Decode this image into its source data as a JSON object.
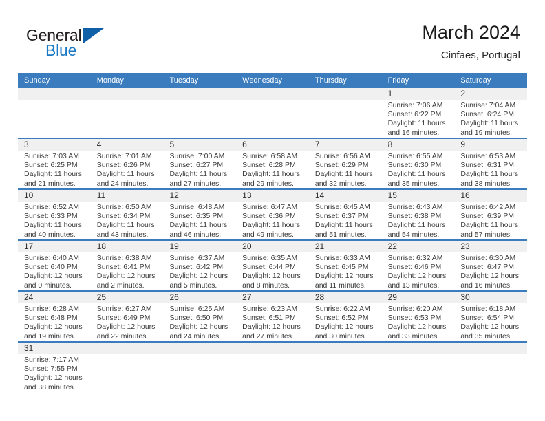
{
  "brand": {
    "name_top": "General",
    "name_bottom": "Blue",
    "color_black": "#231f20",
    "color_blue": "#1878c4",
    "triangle_color": "#1060a8"
  },
  "header": {
    "title": "March 2024",
    "subtitle": "Cinfaes, Portugal"
  },
  "colors": {
    "header_bar": "#3a7cbe",
    "row_separator": "#3a7cbe",
    "daynum_band": "#f0f0f0",
    "text": "#3a3a3a"
  },
  "weekdays": [
    "Sunday",
    "Monday",
    "Tuesday",
    "Wednesday",
    "Thursday",
    "Friday",
    "Saturday"
  ],
  "weeks": [
    {
      "days": [
        {
          "num": "",
          "lines": [
            "",
            "",
            "",
            ""
          ]
        },
        {
          "num": "",
          "lines": [
            "",
            "",
            "",
            ""
          ]
        },
        {
          "num": "",
          "lines": [
            "",
            "",
            "",
            ""
          ]
        },
        {
          "num": "",
          "lines": [
            "",
            "",
            "",
            ""
          ]
        },
        {
          "num": "",
          "lines": [
            "",
            "",
            "",
            ""
          ]
        },
        {
          "num": "1",
          "lines": [
            "Sunrise: 7:06 AM",
            "Sunset: 6:22 PM",
            "Daylight: 11 hours",
            "and 16 minutes."
          ]
        },
        {
          "num": "2",
          "lines": [
            "Sunrise: 7:04 AM",
            "Sunset: 6:24 PM",
            "Daylight: 11 hours",
            "and 19 minutes."
          ]
        }
      ]
    },
    {
      "days": [
        {
          "num": "3",
          "lines": [
            "Sunrise: 7:03 AM",
            "Sunset: 6:25 PM",
            "Daylight: 11 hours",
            "and 21 minutes."
          ]
        },
        {
          "num": "4",
          "lines": [
            "Sunrise: 7:01 AM",
            "Sunset: 6:26 PM",
            "Daylight: 11 hours",
            "and 24 minutes."
          ]
        },
        {
          "num": "5",
          "lines": [
            "Sunrise: 7:00 AM",
            "Sunset: 6:27 PM",
            "Daylight: 11 hours",
            "and 27 minutes."
          ]
        },
        {
          "num": "6",
          "lines": [
            "Sunrise: 6:58 AM",
            "Sunset: 6:28 PM",
            "Daylight: 11 hours",
            "and 29 minutes."
          ]
        },
        {
          "num": "7",
          "lines": [
            "Sunrise: 6:56 AM",
            "Sunset: 6:29 PM",
            "Daylight: 11 hours",
            "and 32 minutes."
          ]
        },
        {
          "num": "8",
          "lines": [
            "Sunrise: 6:55 AM",
            "Sunset: 6:30 PM",
            "Daylight: 11 hours",
            "and 35 minutes."
          ]
        },
        {
          "num": "9",
          "lines": [
            "Sunrise: 6:53 AM",
            "Sunset: 6:31 PM",
            "Daylight: 11 hours",
            "and 38 minutes."
          ]
        }
      ]
    },
    {
      "days": [
        {
          "num": "10",
          "lines": [
            "Sunrise: 6:52 AM",
            "Sunset: 6:33 PM",
            "Daylight: 11 hours",
            "and 40 minutes."
          ]
        },
        {
          "num": "11",
          "lines": [
            "Sunrise: 6:50 AM",
            "Sunset: 6:34 PM",
            "Daylight: 11 hours",
            "and 43 minutes."
          ]
        },
        {
          "num": "12",
          "lines": [
            "Sunrise: 6:48 AM",
            "Sunset: 6:35 PM",
            "Daylight: 11 hours",
            "and 46 minutes."
          ]
        },
        {
          "num": "13",
          "lines": [
            "Sunrise: 6:47 AM",
            "Sunset: 6:36 PM",
            "Daylight: 11 hours",
            "and 49 minutes."
          ]
        },
        {
          "num": "14",
          "lines": [
            "Sunrise: 6:45 AM",
            "Sunset: 6:37 PM",
            "Daylight: 11 hours",
            "and 51 minutes."
          ]
        },
        {
          "num": "15",
          "lines": [
            "Sunrise: 6:43 AM",
            "Sunset: 6:38 PM",
            "Daylight: 11 hours",
            "and 54 minutes."
          ]
        },
        {
          "num": "16",
          "lines": [
            "Sunrise: 6:42 AM",
            "Sunset: 6:39 PM",
            "Daylight: 11 hours",
            "and 57 minutes."
          ]
        }
      ]
    },
    {
      "days": [
        {
          "num": "17",
          "lines": [
            "Sunrise: 6:40 AM",
            "Sunset: 6:40 PM",
            "Daylight: 12 hours",
            "and 0 minutes."
          ]
        },
        {
          "num": "18",
          "lines": [
            "Sunrise: 6:38 AM",
            "Sunset: 6:41 PM",
            "Daylight: 12 hours",
            "and 2 minutes."
          ]
        },
        {
          "num": "19",
          "lines": [
            "Sunrise: 6:37 AM",
            "Sunset: 6:42 PM",
            "Daylight: 12 hours",
            "and 5 minutes."
          ]
        },
        {
          "num": "20",
          "lines": [
            "Sunrise: 6:35 AM",
            "Sunset: 6:44 PM",
            "Daylight: 12 hours",
            "and 8 minutes."
          ]
        },
        {
          "num": "21",
          "lines": [
            "Sunrise: 6:33 AM",
            "Sunset: 6:45 PM",
            "Daylight: 12 hours",
            "and 11 minutes."
          ]
        },
        {
          "num": "22",
          "lines": [
            "Sunrise: 6:32 AM",
            "Sunset: 6:46 PM",
            "Daylight: 12 hours",
            "and 13 minutes."
          ]
        },
        {
          "num": "23",
          "lines": [
            "Sunrise: 6:30 AM",
            "Sunset: 6:47 PM",
            "Daylight: 12 hours",
            "and 16 minutes."
          ]
        }
      ]
    },
    {
      "days": [
        {
          "num": "24",
          "lines": [
            "Sunrise: 6:28 AM",
            "Sunset: 6:48 PM",
            "Daylight: 12 hours",
            "and 19 minutes."
          ]
        },
        {
          "num": "25",
          "lines": [
            "Sunrise: 6:27 AM",
            "Sunset: 6:49 PM",
            "Daylight: 12 hours",
            "and 22 minutes."
          ]
        },
        {
          "num": "26",
          "lines": [
            "Sunrise: 6:25 AM",
            "Sunset: 6:50 PM",
            "Daylight: 12 hours",
            "and 24 minutes."
          ]
        },
        {
          "num": "27",
          "lines": [
            "Sunrise: 6:23 AM",
            "Sunset: 6:51 PM",
            "Daylight: 12 hours",
            "and 27 minutes."
          ]
        },
        {
          "num": "28",
          "lines": [
            "Sunrise: 6:22 AM",
            "Sunset: 6:52 PM",
            "Daylight: 12 hours",
            "and 30 minutes."
          ]
        },
        {
          "num": "29",
          "lines": [
            "Sunrise: 6:20 AM",
            "Sunset: 6:53 PM",
            "Daylight: 12 hours",
            "and 33 minutes."
          ]
        },
        {
          "num": "30",
          "lines": [
            "Sunrise: 6:18 AM",
            "Sunset: 6:54 PM",
            "Daylight: 12 hours",
            "and 35 minutes."
          ]
        }
      ]
    },
    {
      "days": [
        {
          "num": "31",
          "lines": [
            "Sunrise: 7:17 AM",
            "Sunset: 7:55 PM",
            "Daylight: 12 hours",
            "and 38 minutes."
          ]
        },
        {
          "num": "",
          "lines": [
            "",
            "",
            "",
            ""
          ]
        },
        {
          "num": "",
          "lines": [
            "",
            "",
            "",
            ""
          ]
        },
        {
          "num": "",
          "lines": [
            "",
            "",
            "",
            ""
          ]
        },
        {
          "num": "",
          "lines": [
            "",
            "",
            "",
            ""
          ]
        },
        {
          "num": "",
          "lines": [
            "",
            "",
            "",
            ""
          ]
        },
        {
          "num": "",
          "lines": [
            "",
            "",
            "",
            ""
          ]
        }
      ]
    }
  ]
}
